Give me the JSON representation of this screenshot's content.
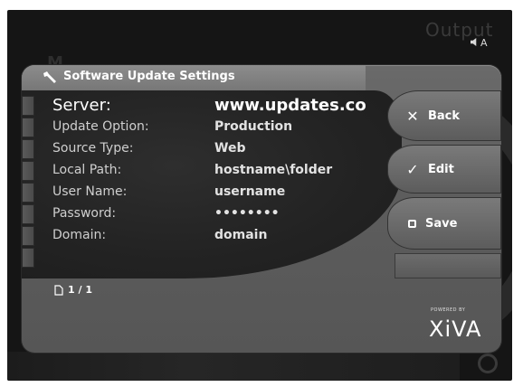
{
  "background": {
    "top_right_word": "Output",
    "mode_letter": "A",
    "left_deco": "M"
  },
  "panel": {
    "title": "Software Update Settings",
    "fields": [
      {
        "label": "Server:",
        "value": "www.updates.co"
      },
      {
        "label": "Update Option:",
        "value": "Production"
      },
      {
        "label": "Source Type:",
        "value": "Web"
      },
      {
        "label": "Local Path:",
        "value": "hostname\\folder"
      },
      {
        "label": "User Name:",
        "value": "username"
      },
      {
        "label": "Password:",
        "value": "••••••••"
      },
      {
        "label": "Domain:",
        "value": "domain"
      }
    ],
    "page_counter": "1 / 1"
  },
  "buttons": {
    "back": {
      "label": "Back",
      "icon": "close-icon"
    },
    "edit": {
      "label": "Edit",
      "icon": "checkmark-icon"
    },
    "save": {
      "label": "Save",
      "icon": "save-icon"
    }
  },
  "branding": {
    "powered_by": "POWERED BY",
    "logo": "XiVA"
  },
  "colors": {
    "panel": "#606060",
    "header": "#808080",
    "dark_area": "#242424",
    "text_primary": "#ffffff"
  }
}
